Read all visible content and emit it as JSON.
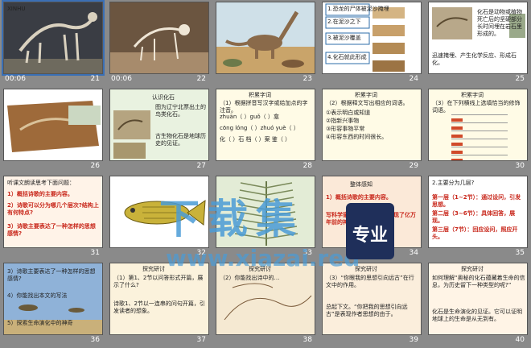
{
  "slides": [
    {
      "id": "s21",
      "num": "21",
      "time": "00:06",
      "texts": [
        "XINHU"
      ]
    },
    {
      "id": "s22",
      "num": "22",
      "time": "00:06",
      "texts": []
    },
    {
      "id": "s23",
      "num": "23",
      "time": "",
      "texts": []
    },
    {
      "id": "s24",
      "num": "24",
      "time": "",
      "texts": [
        "1.恐龙的尸体被泥沙掩埋",
        "2.在泥沙之下",
        "3.被泥沙覆盖",
        "4.化石就此形成"
      ]
    },
    {
      "id": "s25",
      "num": "25",
      "time": "",
      "texts": [
        "化石是动物或植物死亡后的坚硬部分长时间埋在岩石里形成的。",
        "迅速掩埋、产生化学反应、形成石化。"
      ]
    },
    {
      "id": "s26",
      "num": "26",
      "time": "",
      "texts": []
    },
    {
      "id": "s27",
      "num": "27",
      "time": "",
      "texts": [
        "认识化石",
        "图为辽宁北票出土的鸟类化石。",
        "古生物化石是地球历史的见证。"
      ]
    },
    {
      "id": "s28",
      "num": "28",
      "time": "",
      "texts": [
        "积累字词",
        "（1）根据拼音写汉字或给加点的字注音。",
        "zhuān（ ）guǒ（ ）龛",
        "cōng lóng（ ）zhuó yuè（ ）",
        "化（ ）石 档（ ）案 鉴（ ）"
      ]
    },
    {
      "id": "s29",
      "num": "29",
      "time": "",
      "texts": [
        "积累字词",
        "（2）根据释文写出相应的词语。",
        "①表示明白或知道",
        "②指新兴事物",
        "③形容事物平常",
        "④形容东西的时间很长。"
      ]
    },
    {
      "id": "s30",
      "num": "30",
      "time": "",
      "texts": [
        "积累字词",
        "（3）在下列横线上选填恰当的修饰词语。"
      ]
    },
    {
      "id": "s31",
      "num": "31",
      "time": "",
      "texts": [
        "听课文朗读思考下面问题：",
        "1）概括诗歌的主要内容。",
        "2）诗歌可以分为哪几个层次?结构上有何特点?",
        "3）诗歌主要表达了一种怎样的思想感情?"
      ]
    },
    {
      "id": "s32",
      "num": "32",
      "time": "",
      "texts": []
    },
    {
      "id": "s33",
      "num": "33",
      "time": "",
      "texts": []
    },
    {
      "id": "s34",
      "num": "34",
      "time": "",
      "texts": [
        "整体感知",
        "1）概括诗歌的主要内容。",
        "写科学家通过研究化石，展现了亿万年前的神奇景象。"
      ]
    },
    {
      "id": "s35",
      "num": "35",
      "time": "",
      "texts": [
        "2.主要分为几层?",
        "第一层（1~2节）：通过设问，引发思想。",
        "第二层（3~6节）：具体回答，展现。",
        "第三层（7节）：回应设问，照应开头。"
      ]
    },
    {
      "id": "s36",
      "num": "36",
      "time": "",
      "texts": [
        "3）诗歌主要表达了一种怎样的思想感情?",
        "4）你能找出本文的写法",
        "5）探索生命演化中的神奇"
      ]
    },
    {
      "id": "s37",
      "num": "37",
      "time": "",
      "texts": [
        "探究研讨",
        "（1）第1、2节以问答形式开篇，展示了什么?",
        "诗歌1、2节以一连串的问句开篇，引发读者的想象。"
      ]
    },
    {
      "id": "s38",
      "num": "38",
      "time": "",
      "texts": [
        "探究研讨",
        "（2）你能找出诗中的…"
      ]
    },
    {
      "id": "s39",
      "num": "39",
      "time": "",
      "texts": [
        "探究研讨",
        "（3）“你眼我的思想引向远古”在行文中的作用。",
        "总起下文。“你把我的思想引向远古”是表现作者思想的由于。"
      ]
    },
    {
      "id": "s40",
      "num": "40",
      "time": "",
      "texts": [
        "探究研讨",
        "如何理解“奥秘的化石蕴藏着生命的信息，为历史留下一种类型的呢?”",
        "化石是生命演化的见证。它可以证明地球上的生命是从无到有。"
      ]
    }
  ],
  "watermark": {
    "text": "下载集",
    "badge": "专业",
    "url": "www.xiazai.red"
  }
}
